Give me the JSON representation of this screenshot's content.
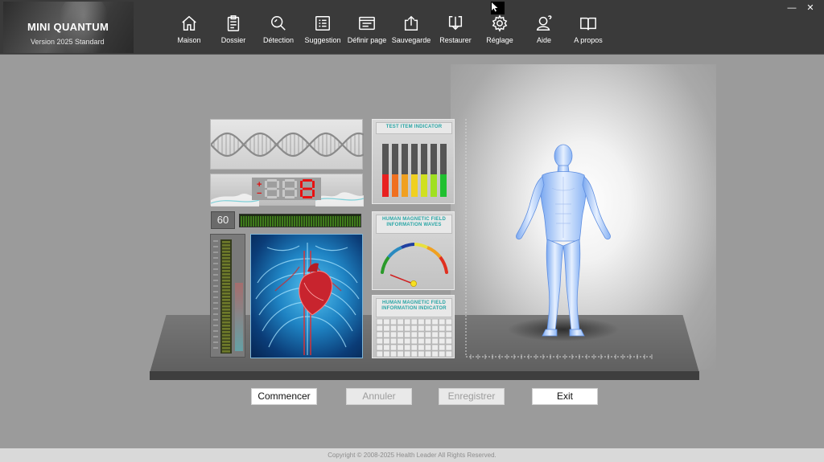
{
  "app": {
    "title": "MINI QUANTUM",
    "version": "Version  2025 Standard"
  },
  "nav": [
    {
      "label": "Maison",
      "icon": "home-icon"
    },
    {
      "label": "Dossier",
      "icon": "clipboard-icon"
    },
    {
      "label": "Détection",
      "icon": "detection-search-icon"
    },
    {
      "label": "Suggestion",
      "icon": "list-icon"
    },
    {
      "label": "Définir page",
      "icon": "page-setup-icon"
    },
    {
      "label": "Sauvegarde",
      "icon": "upload-icon"
    },
    {
      "label": "Restaurer",
      "icon": "download-icon"
    },
    {
      "label": "Réglage",
      "icon": "gear-icon"
    },
    {
      "label": "Aide",
      "icon": "help-user-icon"
    },
    {
      "label": "A propos",
      "icon": "book-icon"
    }
  ],
  "window": {
    "minimize": "—",
    "close": "✕"
  },
  "display": {
    "led_digits": "888",
    "led_plus": "+",
    "led_minus": "−",
    "counter": "60"
  },
  "indicators": {
    "test_item": "TEST ITEM INDICATOR",
    "waves_line1": "HUMAN MAGNETIC FIELD",
    "waves_line2": "INFORMATION WAVES",
    "grid_line1": "HUMAN MAGNETIC FIELD",
    "grid_line2": "INFORMATION INDICATOR",
    "bar_colors": [
      "#e82020",
      "#f07020",
      "#f0a020",
      "#f0d020",
      "#d0e020",
      "#a0e020",
      "#20c030"
    ]
  },
  "buttons": {
    "start": "Commencer",
    "cancel": "Annuler",
    "save": "Enregistrer",
    "exit": "Exit"
  },
  "footer": "Copyright © 2008-2025 Health Leader All Rights Reserved."
}
